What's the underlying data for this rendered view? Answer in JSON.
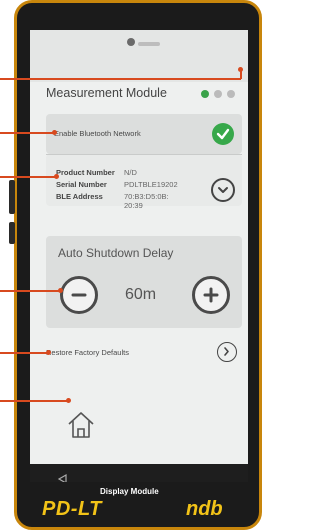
{
  "header": {
    "title": "Measurement Module",
    "page_dots": [
      "active",
      "inactive",
      "inactive"
    ],
    "active_dot_color": "#3aa34a",
    "inactive_dot_color": "#bbbbbb"
  },
  "bluetooth": {
    "label": "Enable Bluetooth Network",
    "enabled": true,
    "check_color": "#37a84a"
  },
  "device_info": {
    "rows": [
      {
        "label": "Product Number",
        "value": "N/D"
      },
      {
        "label": "Serial Number",
        "value": "PDLTBLE19202"
      },
      {
        "label": "BLE Address",
        "value": "70:B3:D5:0B:\n20:39"
      }
    ],
    "expand_icon": "chevron-down-icon"
  },
  "shutdown": {
    "title": "Auto Shutdown Delay",
    "value": "60m",
    "decrease_icon": "minus-icon",
    "increase_icon": "plus-icon"
  },
  "restore": {
    "label": "Restore Factory Defaults",
    "icon": "chevron-right-icon"
  },
  "home": {
    "icon": "home-icon"
  },
  "navbar": {
    "back_icon": "back-triangle-icon"
  },
  "device_labels": {
    "module_caption": "Display Module",
    "model": "PD-LT",
    "brand": "ndb"
  },
  "colors": {
    "frame_accent": "#c8860c",
    "pointer": "#d84a1f",
    "brand_yellow": "#f2c318"
  }
}
